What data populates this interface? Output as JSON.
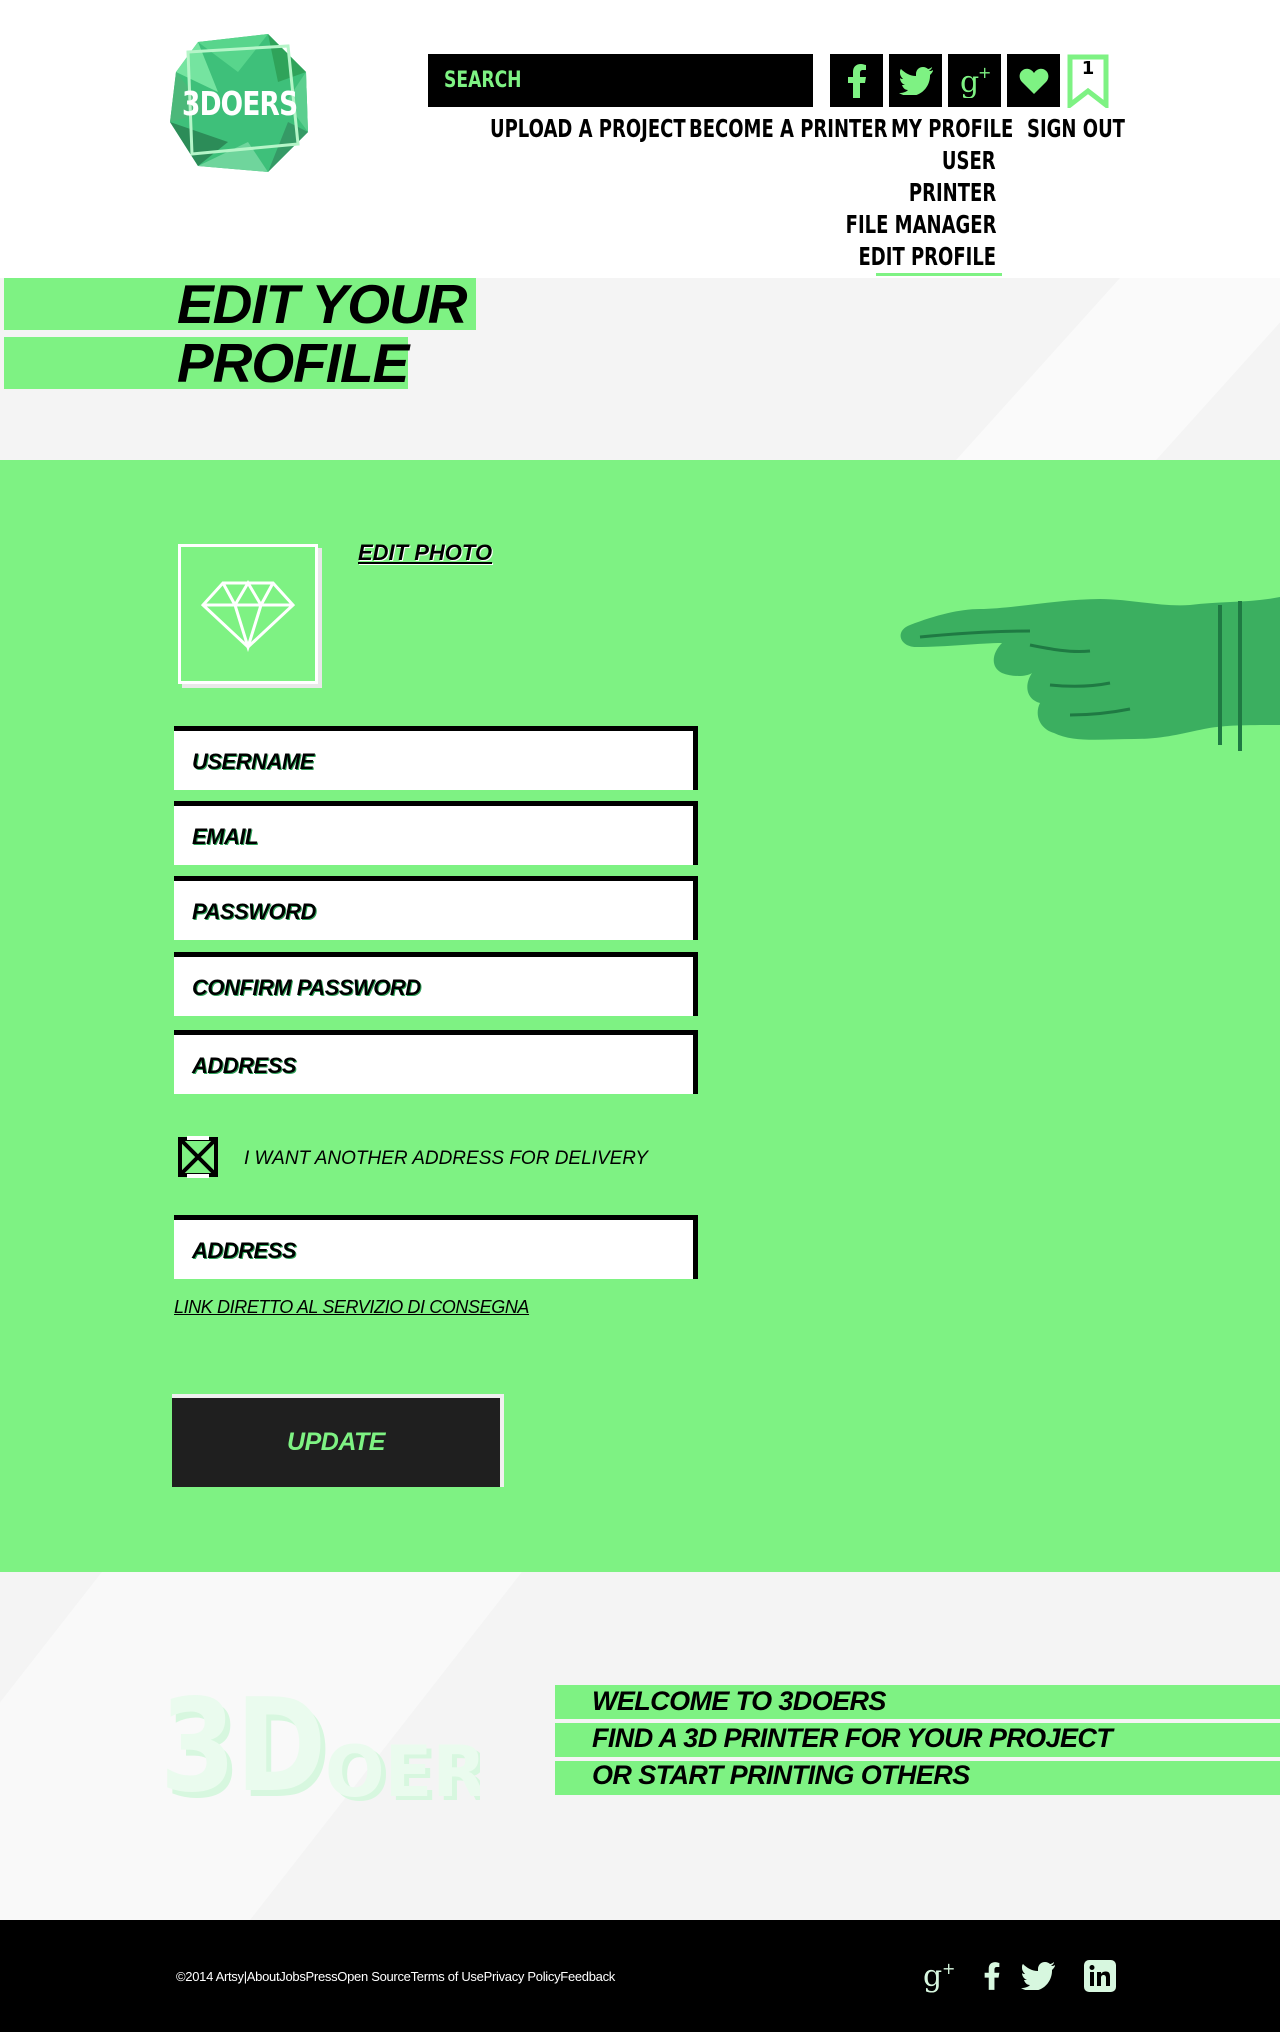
{
  "brand": {
    "logo_text": "3DOERS",
    "accent_color": "#7ef283",
    "dark_color": "#000000"
  },
  "header": {
    "search_placeholder": "SEARCH",
    "social": [
      "facebook-icon",
      "twitter-icon",
      "google-plus-icon",
      "heart-icon"
    ],
    "bookmark_count": "1",
    "nav": {
      "upload": "UPLOAD A PROJECT",
      "printer": "BECOME A PRINTER",
      "profile": "MY PROFILE",
      "signout": "SIGN OUT"
    },
    "profile_menu": {
      "user": "USER",
      "printer": "PRINTER",
      "files": "FILE MANAGER",
      "edit": "EDIT PROFILE"
    }
  },
  "page": {
    "title_line1": "EDIT YOUR",
    "title_line2": "PROFILE"
  },
  "form": {
    "edit_photo": "EDIT PHOTO",
    "username": "USERNAME",
    "email": "EMAIL",
    "password": "PASSWORD",
    "confirm_password": "CONFIRM PASSWORD",
    "address": "ADDRESS",
    "delivery_checkbox": "I WANT  ANOTHER ADDRESS FOR DELIVERY",
    "delivery_address": "ADDRESS",
    "delivery_link": "LINK DIRETTO AL SERVIZIO DI CONSEGNA",
    "update": "UPDATE"
  },
  "promo": {
    "line1": "WELCOME TO 3DOERS",
    "line2": "FIND A 3D PRINTER FOR YOUR  PROJECT",
    "line3": "OR START PRINTING  OTHERS"
  },
  "footer": {
    "copyright": "©2014 Artsy|",
    "links": [
      "About",
      "Jobs",
      "Press",
      "Open Source",
      "Terms of Use",
      "Privacy Policy",
      "Feedback"
    ],
    "social": [
      "google-plus-icon",
      "facebook-icon",
      "twitter-icon",
      "linkedin-icon"
    ]
  }
}
